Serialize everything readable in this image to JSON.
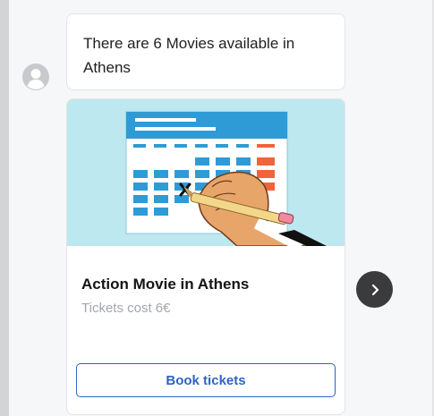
{
  "message": {
    "text": "There are 6 Movies available in Athens"
  },
  "card": {
    "image_icon": "calendar-hand-icon",
    "title": "Action Movie in Athens",
    "subtitle": "Tickets cost 6€",
    "button_label": "Book tickets"
  },
  "carousel": {
    "next_icon": "chevron-right-icon"
  },
  "colors": {
    "accent": "#2f63c4",
    "calendar_header": "#2f9bd6",
    "calendar_cell": "#2f9bd6",
    "calendar_weekend": "#f0643c",
    "image_background": "#bde8f0",
    "next_button": "#3b3b3d"
  }
}
